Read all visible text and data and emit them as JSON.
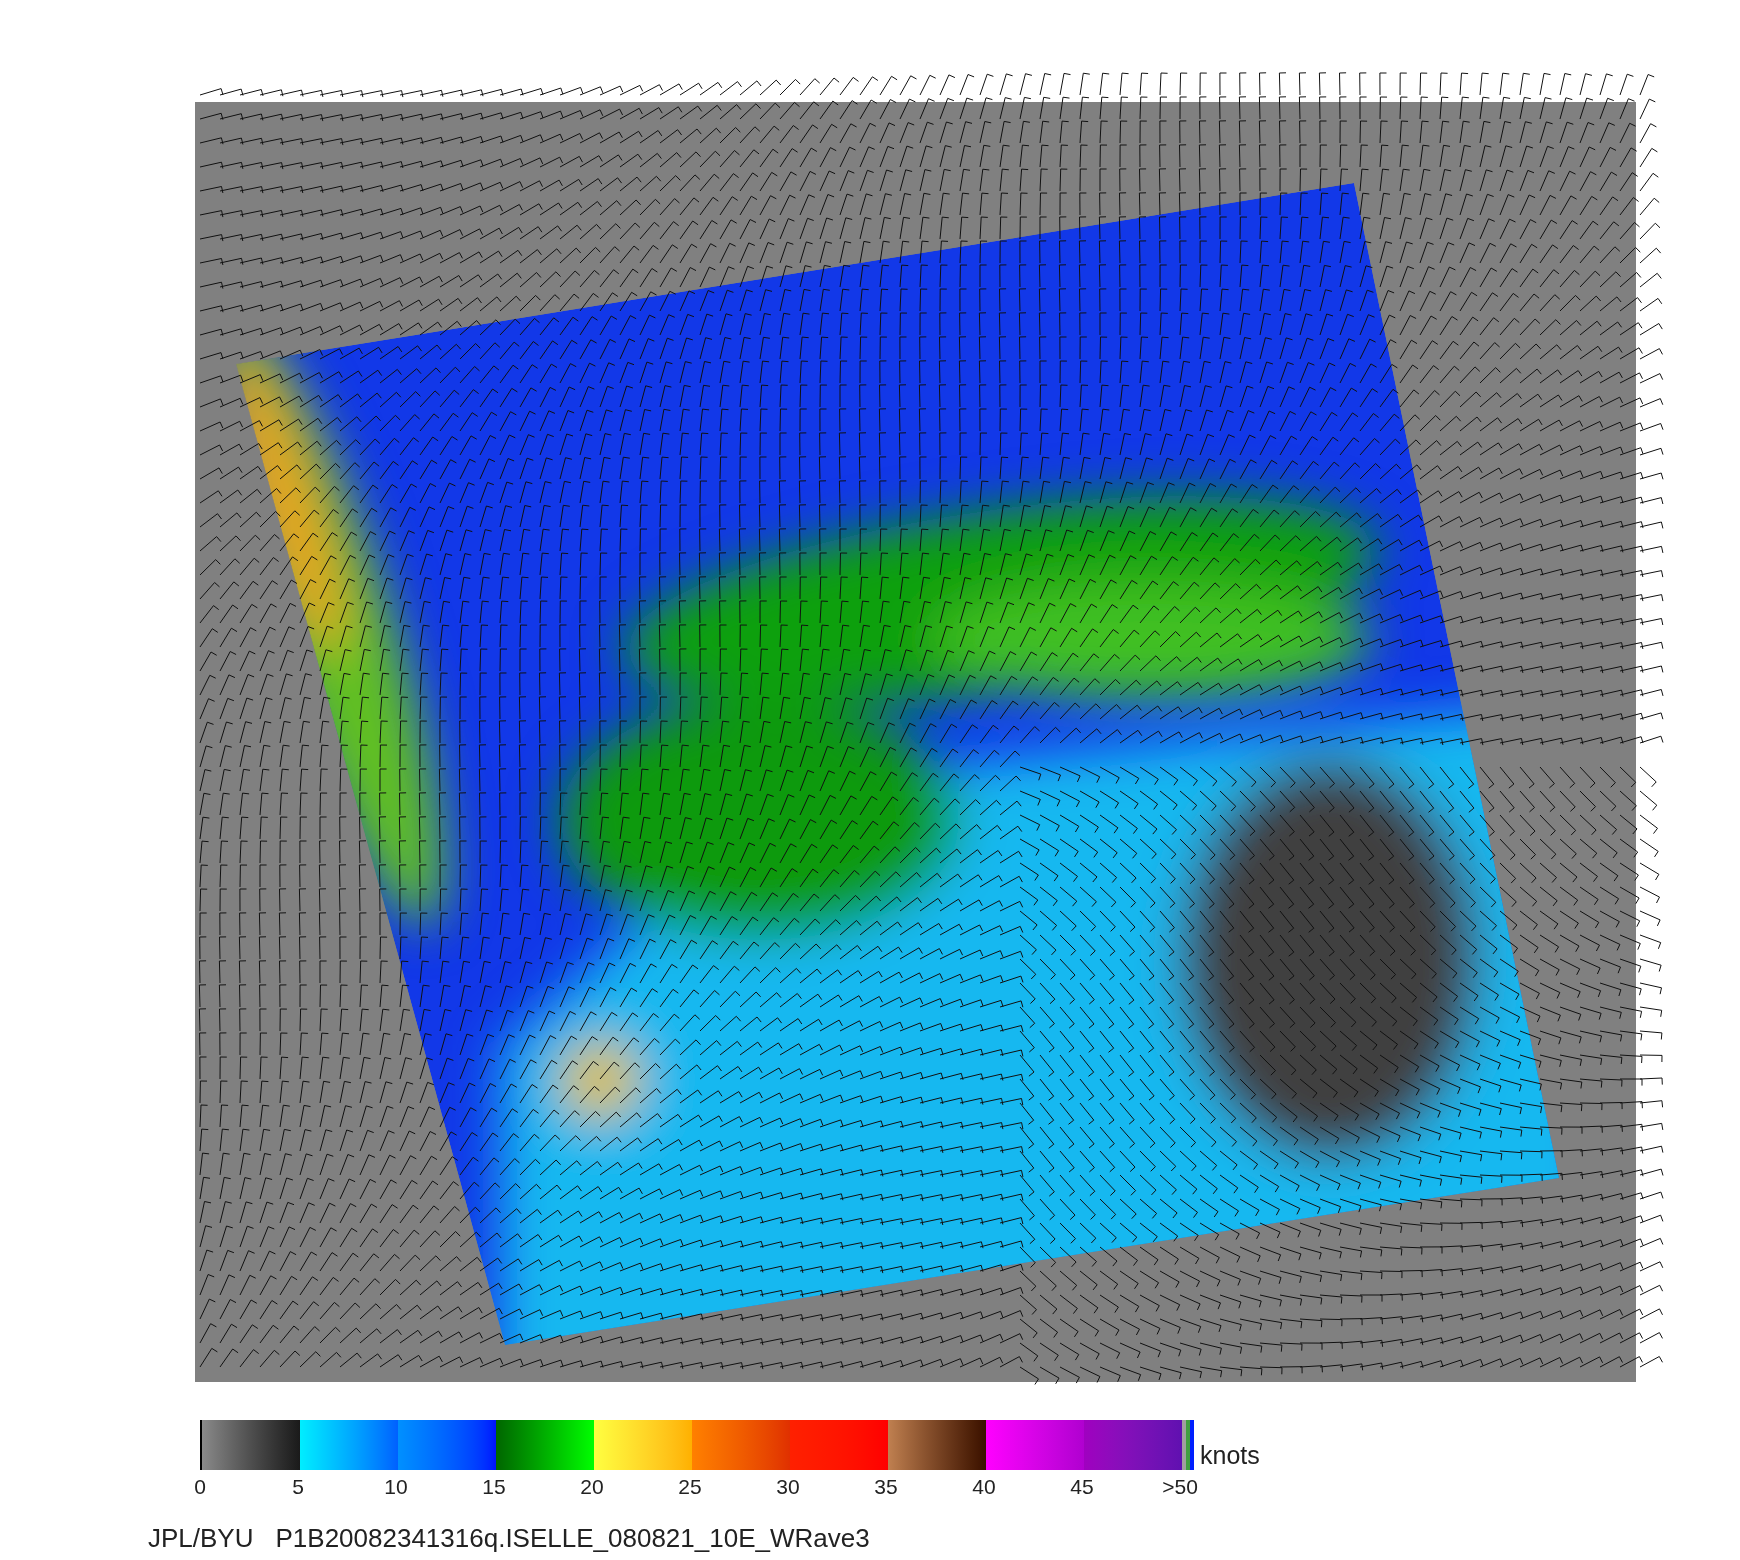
{
  "colorbar": {
    "ticks": [
      "0",
      "5",
      "10",
      "15",
      "20",
      "25",
      "30",
      "35",
      "40",
      "45",
      ">50"
    ],
    "unit": "knots"
  },
  "caption": {
    "source": "JPL/BYU",
    "file": "P1B20082341316q.ISELLE_080821_10E_WRave3"
  }
}
